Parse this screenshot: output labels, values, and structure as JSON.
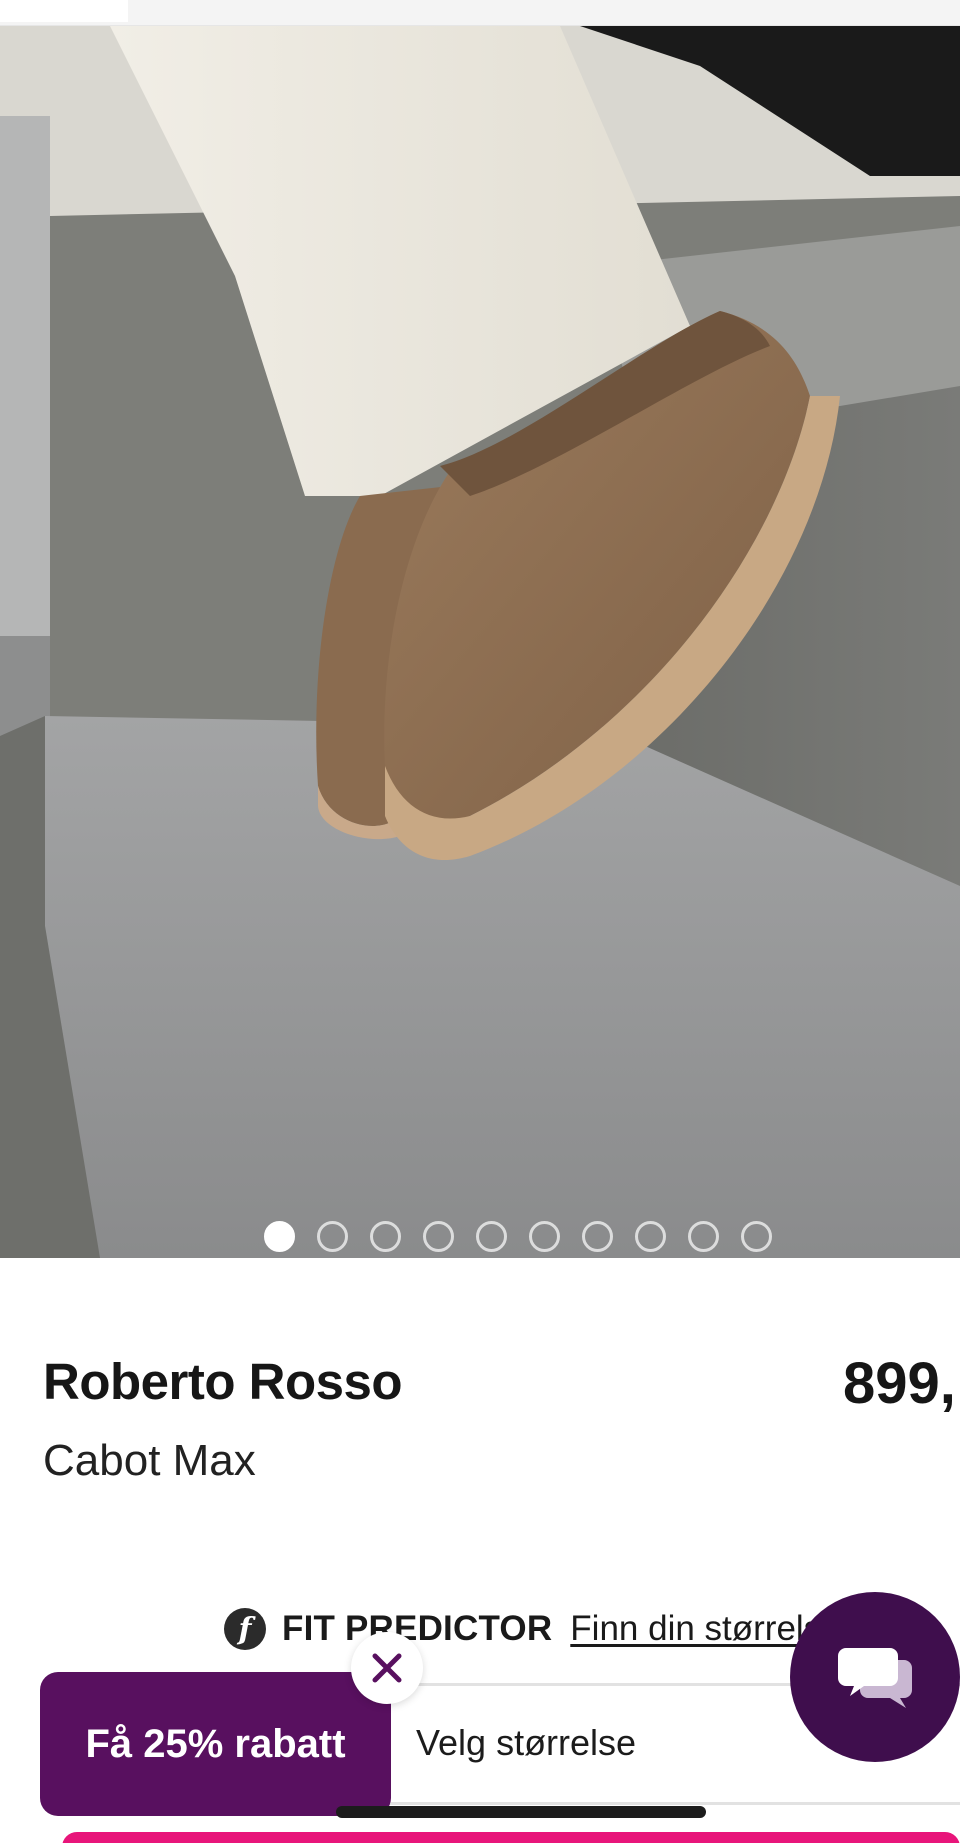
{
  "product": {
    "brand": "Roberto Rosso",
    "name": "Cabot Max",
    "price": "899,"
  },
  "gallery": {
    "image_subject": "suede-platform-slipper-photo",
    "total_images": 10,
    "active_index": 0
  },
  "fit_predictor": {
    "logo_letter": "f",
    "title": "FIT PREDICTOR",
    "link_text": "Finn din størrelse"
  },
  "size_selector": {
    "label": "Velg størrelse"
  },
  "promo": {
    "label": "Få 25% rabatt",
    "close_icon": "close-icon"
  },
  "chat": {
    "icon": "chat-bubbles-icon"
  },
  "colors": {
    "promo_bg": "#58105f",
    "chat_bg": "#3f0e4d",
    "cta_bg": "#e8157a",
    "text": "#161616"
  }
}
